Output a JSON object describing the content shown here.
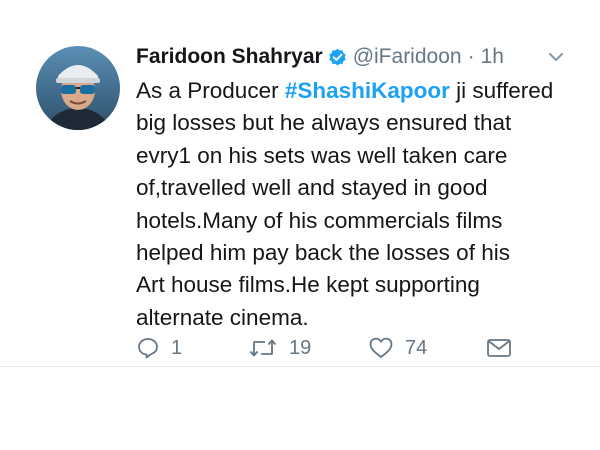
{
  "tweet": {
    "author_name": "Faridoon Shahryar",
    "handle": "@iFaridoon",
    "separator": "·",
    "time": "1h",
    "text_lines": [
      {
        "before": "As a Producer ",
        "hashtag": "#ShashiKapoor",
        "after": " ji suffered"
      },
      "big losses but he always ensured that",
      "evry1 on his sets was well taken care",
      "of,travelled well and stayed in good",
      "hotels.Many of his commercials films",
      "helped him pay back the losses of his",
      "Art house films.He kept supporting",
      "alternate cinema."
    ],
    "actions": {
      "reply_count": "1",
      "retweet_count": "19",
      "like_count": "74"
    },
    "icons": {
      "verified": "verified-badge-icon",
      "caret": "chevron-down-icon",
      "reply": "reply-icon",
      "retweet": "retweet-icon",
      "like": "heart-icon",
      "dm": "envelope-icon"
    },
    "colors": {
      "hashtag": "#1da1f2",
      "verified": "#1da1f2",
      "secondary_text": "#657786",
      "primary_text": "#14171a"
    }
  }
}
